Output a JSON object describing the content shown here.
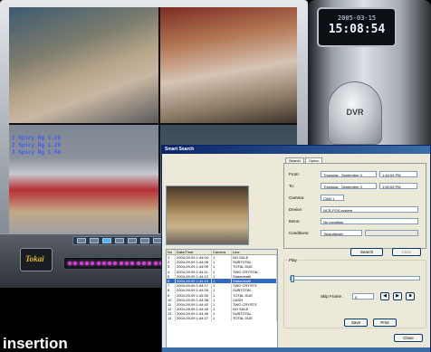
{
  "tower": {
    "date": "2005-03-15",
    "time": "15:08:54",
    "label": "DVR"
  },
  "monitor": {
    "logo": "Tokai",
    "cam3_lines": [
      "1  Spicy Bg 1.29",
      "2  Spicy Bg   1.29",
      "3  Spicy Bg   1.08"
    ],
    "led_count": 18
  },
  "caption": "insertion",
  "dialog": {
    "title": "Smart Search",
    "tabs": [
      "Search",
      "Option"
    ],
    "fields": [
      {
        "label": "From:",
        "date": "Thursday , September 0",
        "time": "1:44:00 PM"
      },
      {
        "label": "To:",
        "date": "Thursday , September 0",
        "time": "1:59:00 PM"
      }
    ],
    "camera": {
      "label": "Camera:",
      "value": "CAM 1"
    },
    "device": {
      "label": "Device:",
      "value": "NCR-POS system"
    },
    "items": {
      "label": "Items:",
      "value": "No condition"
    },
    "conditions": {
      "label": "Conditions:",
      "value": "Totalofdeath"
    },
    "search_button": "Search",
    "clear_button": "Clear",
    "table": {
      "headers": [
        "No",
        "Date/Time",
        "Camera",
        "Line"
      ],
      "selected_index": 5,
      "rows": [
        [
          "1",
          "2004-09-09 1:44:04",
          "1",
          "NO SALE"
        ],
        [
          "2",
          "2004-09-09 1:44:08",
          "1",
          "SUBTOTAL"
        ],
        [
          "3",
          "2004-09-09 1:44:09",
          "1",
          "TOTAL DUE"
        ],
        [
          "4",
          "2004-09-09 1:44:11",
          "1",
          "TWO CRYSTAL"
        ],
        [
          "5",
          "2004-09-09 1:44:12",
          "1",
          "Stakedeath"
        ],
        [
          "6",
          "2004-09-09 1:44:13",
          "1",
          "Stakedeath"
        ],
        [
          "7",
          "2004-09-09 1:44:17",
          "1",
          "TWO CRYSTS"
        ],
        [
          "8",
          "2004-09-09 1:44:26",
          "1",
          "SUBTOTAL"
        ],
        [
          "9",
          "2004-09-09 1:44:30",
          "1",
          "TOTAL DUE"
        ],
        [
          "10",
          "2004-09-09 1:44:38",
          "1",
          "CASH"
        ],
        [
          "11",
          "2004-09-09 1:44:42",
          "1",
          "TWO CRYSTS"
        ],
        [
          "12",
          "2004-09-09 1:44:45",
          "1",
          "NO SALE"
        ],
        [
          "13",
          "2004-09-09 1:44:46",
          "1",
          "SUBTOTAL"
        ],
        [
          "14",
          "2004-09-09 1:44:47",
          "1",
          "TOTAL DUE"
        ]
      ]
    },
    "play": {
      "label": "Play",
      "skip_label": "Skip Frame :",
      "skip_value": "0",
      "save": "Save",
      "print": "Print",
      "close": "Close"
    }
  }
}
